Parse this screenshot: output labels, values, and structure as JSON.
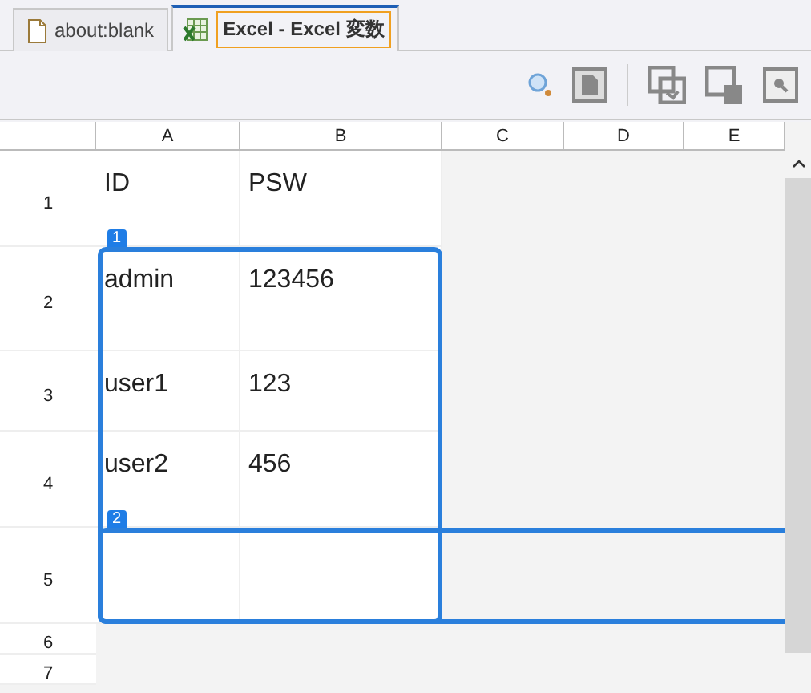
{
  "tabs": [
    {
      "label": "about:blank",
      "kind": "page",
      "selected": false
    },
    {
      "label": "Excel - Excel 変数",
      "kind": "excel",
      "selected": true
    }
  ],
  "toolbar": [
    {
      "kind": "search"
    },
    {
      "kind": "document"
    },
    {
      "kind": "separator"
    },
    {
      "kind": "windows"
    },
    {
      "kind": "window-trash"
    },
    {
      "kind": "window-search"
    }
  ],
  "sheet": {
    "columns": [
      "A",
      "B",
      "C",
      "D",
      "E"
    ],
    "rows": [
      {
        "header": "1",
        "cells": [
          "ID",
          "PSW"
        ]
      },
      {
        "header": "2",
        "cells": [
          "admin",
          "123456"
        ]
      },
      {
        "header": "3",
        "cells": [
          "user1",
          "123"
        ]
      },
      {
        "header": "4",
        "cells": [
          "user2",
          "456"
        ]
      },
      {
        "header": "5",
        "cells": [
          "",
          ""
        ]
      },
      {
        "header": "6",
        "cells": []
      },
      {
        "header": "7",
        "cells": []
      }
    ],
    "selections": [
      {
        "label": "1"
      },
      {
        "label": "2"
      }
    ]
  }
}
